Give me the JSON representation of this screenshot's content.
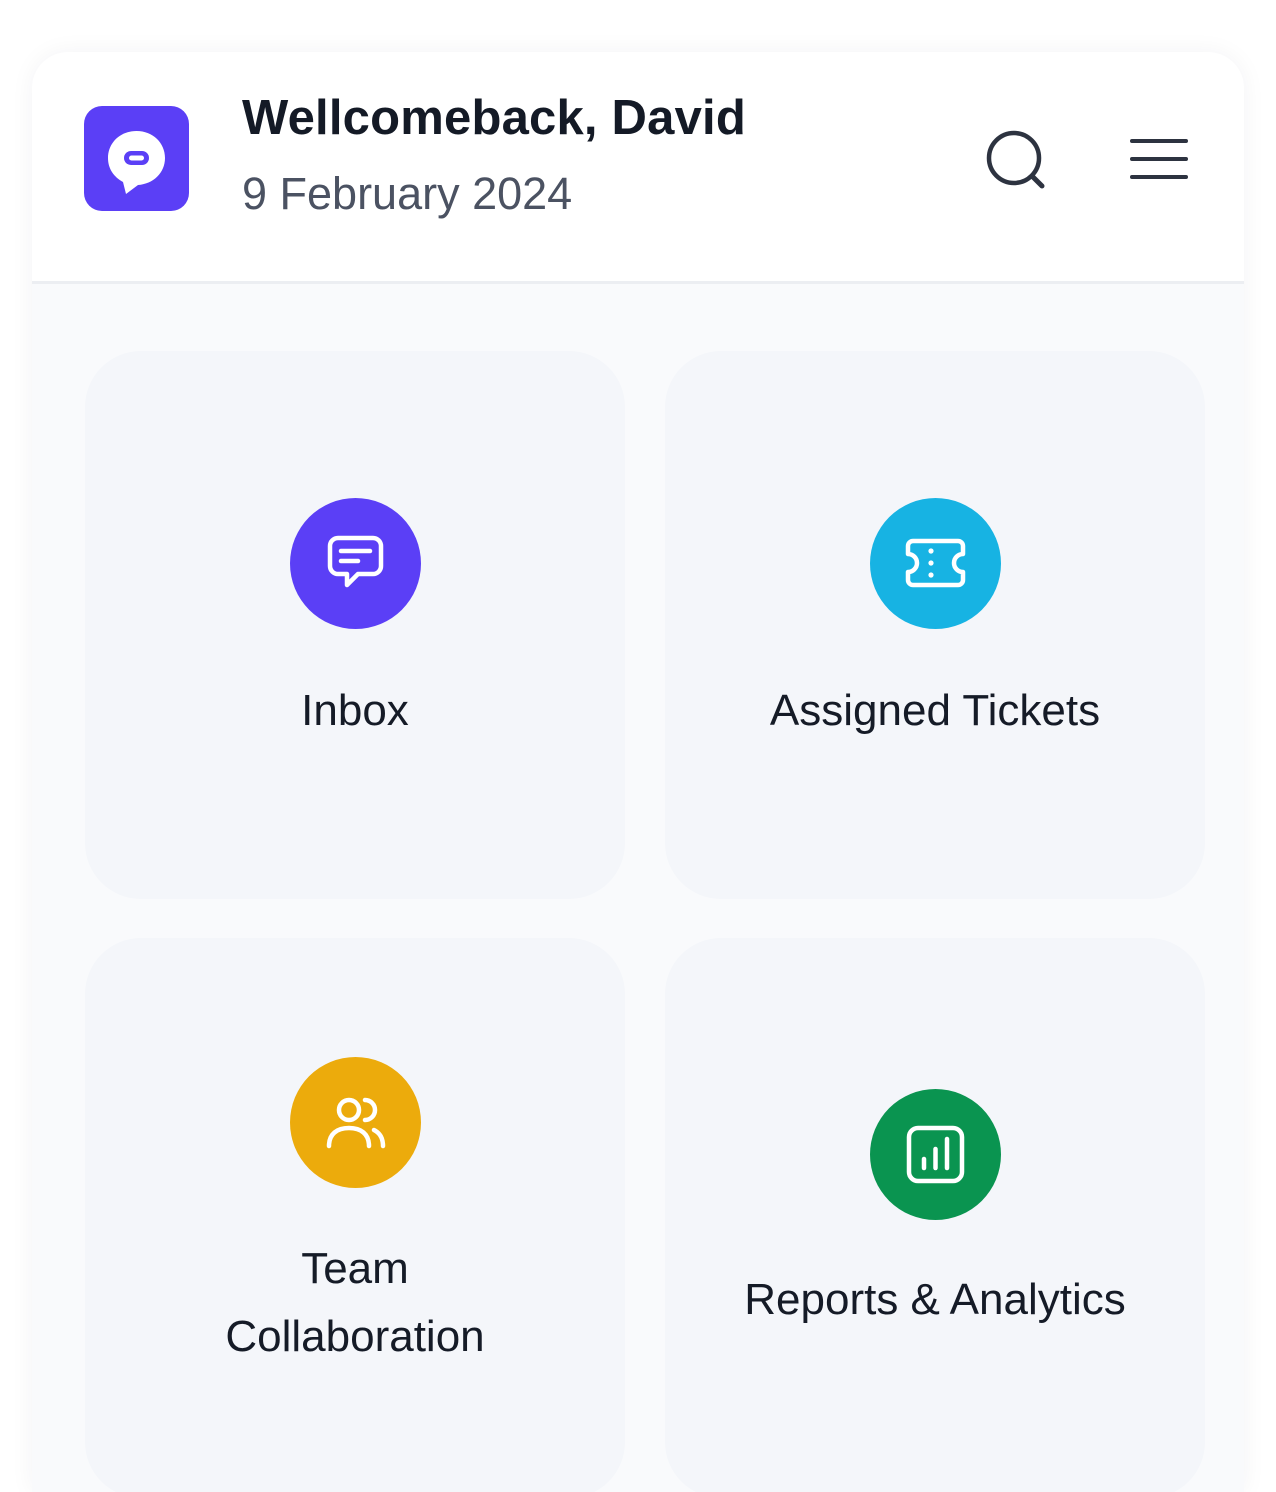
{
  "header": {
    "greeting": "Wellcomeback, David",
    "date": "9 February 2024",
    "logo_icon": "chat-bubble-logo-icon",
    "search_icon": "search-icon",
    "menu_icon": "hamburger-menu-icon"
  },
  "tiles": [
    {
      "label": "Inbox",
      "icon": "message-icon",
      "color": "#5b3ff6"
    },
    {
      "label": "Assigned Tickets",
      "icon": "ticket-icon",
      "color": "#17b3e3"
    },
    {
      "label_lines": [
        "Team",
        "Collaboration"
      ],
      "icon": "users-icon",
      "color": "#ecab0c"
    },
    {
      "label": "Reports & Analytics",
      "icon": "chart-icon",
      "color": "#0a9450"
    }
  ],
  "colors": {
    "brand": "#5b3ff6",
    "text_primary": "#141a26",
    "text_secondary": "#4b5262",
    "tile_background": "#f4f6fa"
  }
}
